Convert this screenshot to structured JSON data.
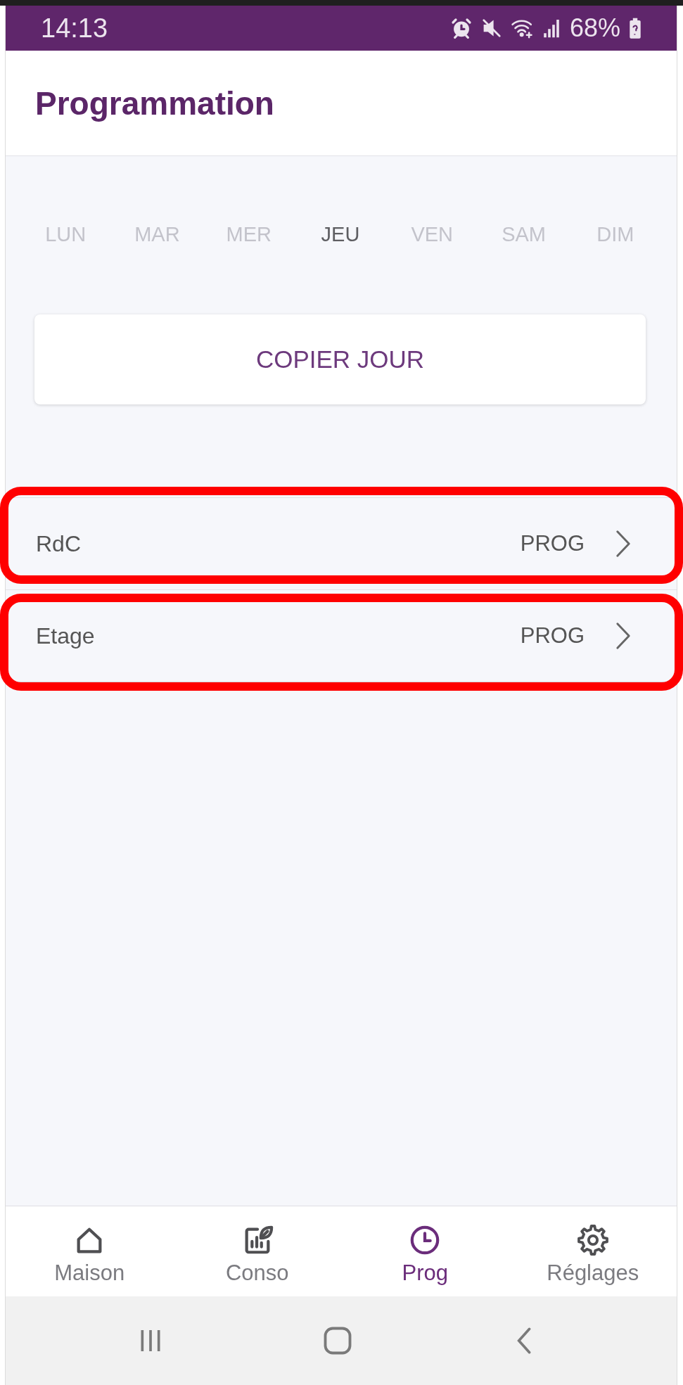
{
  "status_bar": {
    "time": "14:13",
    "battery": "68%"
  },
  "header": {
    "title": "Programmation"
  },
  "days": [
    {
      "label": "LUN",
      "selected": false
    },
    {
      "label": "MAR",
      "selected": false
    },
    {
      "label": "MER",
      "selected": false
    },
    {
      "label": "JEU",
      "selected": true
    },
    {
      "label": "VEN",
      "selected": false
    },
    {
      "label": "SAM",
      "selected": false
    },
    {
      "label": "DIM",
      "selected": false
    }
  ],
  "copy_button": {
    "label": "COPIER JOUR"
  },
  "zones": [
    {
      "name": "RdC",
      "mode": "PROG",
      "highlighted": true
    },
    {
      "name": "Etage",
      "mode": "PROG",
      "highlighted": true
    }
  ],
  "bottom_nav": [
    {
      "label": "Maison",
      "selected": false
    },
    {
      "label": "Conso",
      "selected": false
    },
    {
      "label": "Prog",
      "selected": true
    },
    {
      "label": "Réglages",
      "selected": false
    }
  ]
}
